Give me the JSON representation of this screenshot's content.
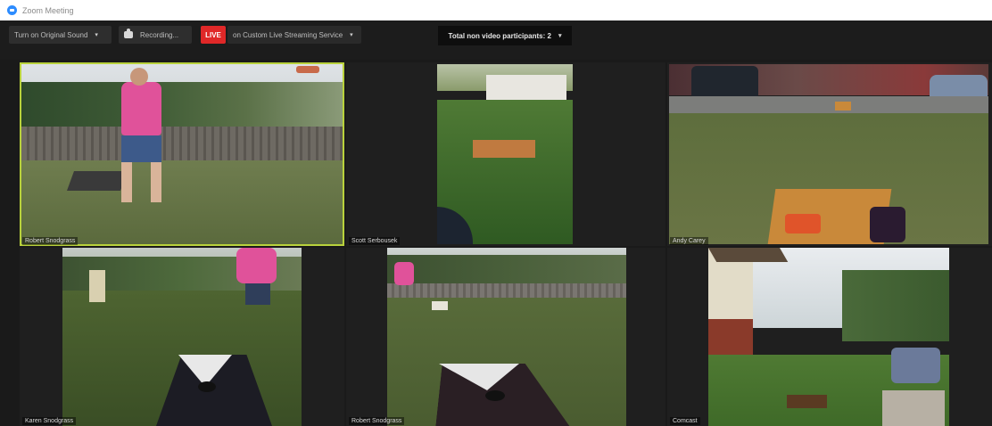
{
  "window": {
    "title": "Zoom Meeting"
  },
  "toolbar": {
    "original_sound": "Turn on Original Sound",
    "recording": "Recording...",
    "live_badge": "LIVE",
    "live_stream": "on Custom Live Streaming Service",
    "participants": "Total non video participants: 2"
  },
  "tiles": [
    {
      "name": "Robert Snodgrass"
    },
    {
      "name": "Scott Serbousek"
    },
    {
      "name": "Andy Carey"
    },
    {
      "name": "Karen Snodgrass"
    },
    {
      "name": "Robert Snodgrass"
    },
    {
      "name": "Comcast"
    }
  ],
  "colors": {
    "active_border": "#b9d23c",
    "live": "#e02828",
    "background": "#1a1a1a"
  }
}
